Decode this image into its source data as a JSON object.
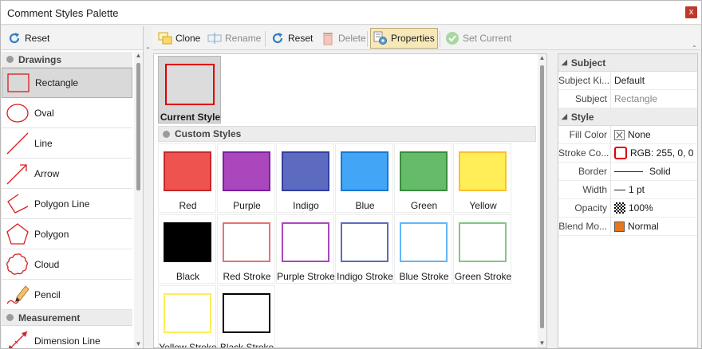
{
  "window": {
    "title": "Comment Styles Palette",
    "close_glyph": "x"
  },
  "left_toolbar": {
    "reset_label": "Reset"
  },
  "left_list": {
    "groups": [
      {
        "label": "Drawings"
      },
      {
        "label": "Measurement"
      }
    ],
    "items": [
      {
        "label": "Rectangle",
        "icon": "rectangle-icon"
      },
      {
        "label": "Oval",
        "icon": "oval-icon"
      },
      {
        "label": "Line",
        "icon": "line-icon"
      },
      {
        "label": "Arrow",
        "icon": "arrow-icon"
      },
      {
        "label": "Polygon Line",
        "icon": "polygon-line-icon"
      },
      {
        "label": "Polygon",
        "icon": "polygon-icon"
      },
      {
        "label": "Cloud",
        "icon": "cloud-icon"
      },
      {
        "label": "Pencil",
        "icon": "pencil-icon"
      },
      {
        "label": "Dimension Line",
        "icon": "dimension-line-icon"
      }
    ]
  },
  "main_toolbar": {
    "clone_label": "Clone",
    "rename_label": "Rename",
    "reset_label": "Reset",
    "delete_label": "Delete",
    "properties_label": "Properties",
    "set_current_label": "Set Current"
  },
  "current_style": {
    "label": "Current Style",
    "stroke_color": "#e00000"
  },
  "custom_styles": {
    "header": "Custom Styles",
    "items": [
      {
        "label": "Red",
        "fill": "#ef5350",
        "stroke": "#c62828"
      },
      {
        "label": "Purple",
        "fill": "#ab47bc",
        "stroke": "#7b1fa2"
      },
      {
        "label": "Indigo",
        "fill": "#5c6bc0",
        "stroke": "#303f9f"
      },
      {
        "label": "Blue",
        "fill": "#42a5f5",
        "stroke": "#1976d2"
      },
      {
        "label": "Green",
        "fill": "#66bb6a",
        "stroke": "#388e3c"
      },
      {
        "label": "Yellow",
        "fill": "#ffee58",
        "stroke": "#fbc02d"
      },
      {
        "label": "Black",
        "fill": "#000000",
        "stroke": "#000000"
      },
      {
        "label": "Red Stroke",
        "fill": "#ffffff",
        "stroke": "#e57373"
      },
      {
        "label": "Purple Stroke",
        "fill": "#ffffff",
        "stroke": "#ab47bc"
      },
      {
        "label": "Indigo Stroke",
        "fill": "#ffffff",
        "stroke": "#5c6bc0"
      },
      {
        "label": "Blue Stroke",
        "fill": "#ffffff",
        "stroke": "#64b5f6"
      },
      {
        "label": "Green Stroke",
        "fill": "#ffffff",
        "stroke": "#81c784"
      },
      {
        "label": "Yellow Stroke",
        "fill": "#ffffff",
        "stroke": "#ffee58"
      },
      {
        "label": "Black Stroke",
        "fill": "#ffffff",
        "stroke": "#000000"
      }
    ]
  },
  "properties": {
    "subject_section": "Subject",
    "subject_kind_key": "Subject Ki...",
    "subject_kind_val": "Default",
    "subject_key": "Subject",
    "subject_val": "Rectangle",
    "style_section": "Style",
    "fill_color_key": "Fill Color",
    "fill_color_val": "None",
    "stroke_color_key": "Stroke Co...",
    "stroke_color_val": "RGB: 255, 0, 0",
    "border_key": "Border",
    "border_val": "Solid",
    "width_key": "Width",
    "width_val": "1 pt",
    "opacity_key": "Opacity",
    "opacity_val": "100%",
    "blend_key": "Blend Mo...",
    "blend_val": "Normal",
    "stroke_swatch_color": "#e00000",
    "blend_swatch_color": "#e8761a"
  }
}
